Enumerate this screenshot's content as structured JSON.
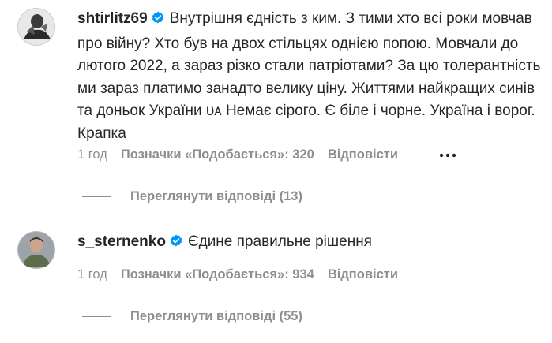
{
  "comments": [
    {
      "username": "shtirlitz69",
      "text": "Внутрішня єдність з ким. З тими хто всі роки мовчав про війну? Хто був на двох стільцях однією попою. Мовчали до лютого 2022, а зараз різко стали патріотами? За цю толерантність ми зараз платимо занадто велику ціну. Життями найкращих синів та доньок України ᴜᴀ Немає сірого. Є біле і чорне. Україна і ворог. Крапка",
      "time": "1 год",
      "likes": "Позначки «Подобається»: 320",
      "reply": "Відповісти",
      "view_replies": "Переглянути відповіді (13)"
    },
    {
      "username": "s_sternenko",
      "text": "Єдине правильне рішення",
      "time": "1 год",
      "likes": "Позначки «Подобається»: 934",
      "reply": "Відповісти",
      "view_replies": "Переглянути відповіді (55)"
    }
  ],
  "icons": {
    "verified": "verified-badge-icon",
    "more": "more-options-icon"
  },
  "colors": {
    "text": "#262626",
    "secondary": "#8e8e8e",
    "verified": "#0095f6"
  }
}
